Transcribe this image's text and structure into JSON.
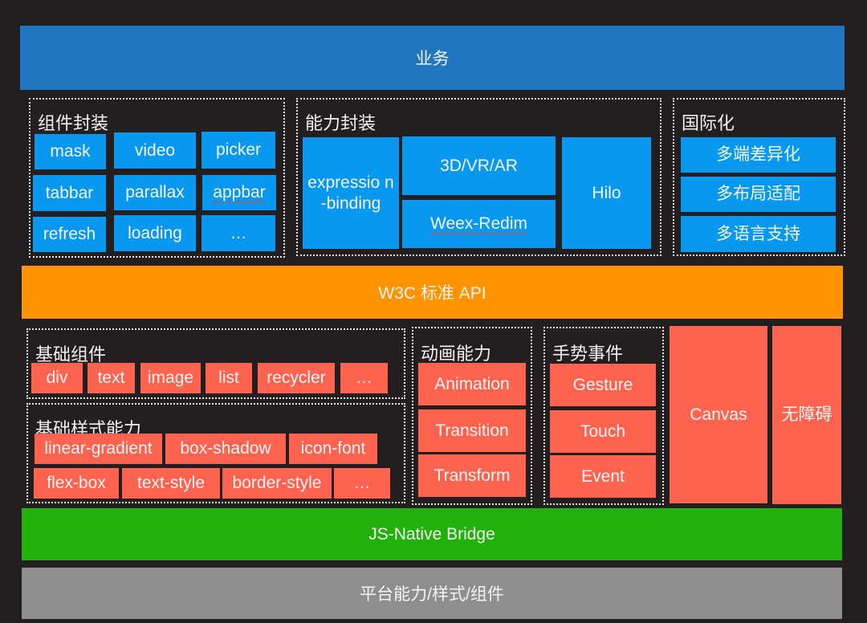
{
  "colors": {
    "background": "#231f20",
    "business": "#2176c0",
    "w3c": "#ff9400",
    "bridge": "#21b10a",
    "platform": "#8e8e8e",
    "blue_cell": "#0998ef",
    "red_cell": "#fe6350"
  },
  "layers": {
    "business": "业务",
    "w3c": "W3C 标准 API",
    "bridge": "JS-Native Bridge",
    "platform": "平台能力/样式/组件"
  },
  "component_wrap": {
    "title": "组件封装",
    "items": [
      "mask",
      "video",
      "picker",
      "tabbar",
      "parallax",
      "appbar",
      "refresh",
      "loading",
      "…"
    ]
  },
  "ability_wrap": {
    "title": "能力封装",
    "items": [
      "expressio n-binding",
      "3D/VR/AR",
      "Weex-Redim",
      "Hilo"
    ]
  },
  "i18n": {
    "title": "国际化",
    "items": [
      "多端差异化",
      "多布局适配",
      "多语言支持"
    ]
  },
  "base_components": {
    "title": "基础组件",
    "items": [
      "div",
      "text",
      "image",
      "list",
      "recycler",
      "…"
    ]
  },
  "base_styles": {
    "title": "基础样式能力",
    "items": [
      "linear-gradient",
      "box-shadow",
      "icon-font",
      "flex-box",
      "text-style",
      "border-style",
      "…"
    ]
  },
  "animation": {
    "title": "动画能力",
    "items": [
      "Animation",
      "Transition",
      "Transform"
    ]
  },
  "gesture": {
    "title": "手势事件",
    "items": [
      "Gesture",
      "Touch",
      "Event"
    ]
  },
  "canvas": "Canvas",
  "accessibility": "无障碍"
}
